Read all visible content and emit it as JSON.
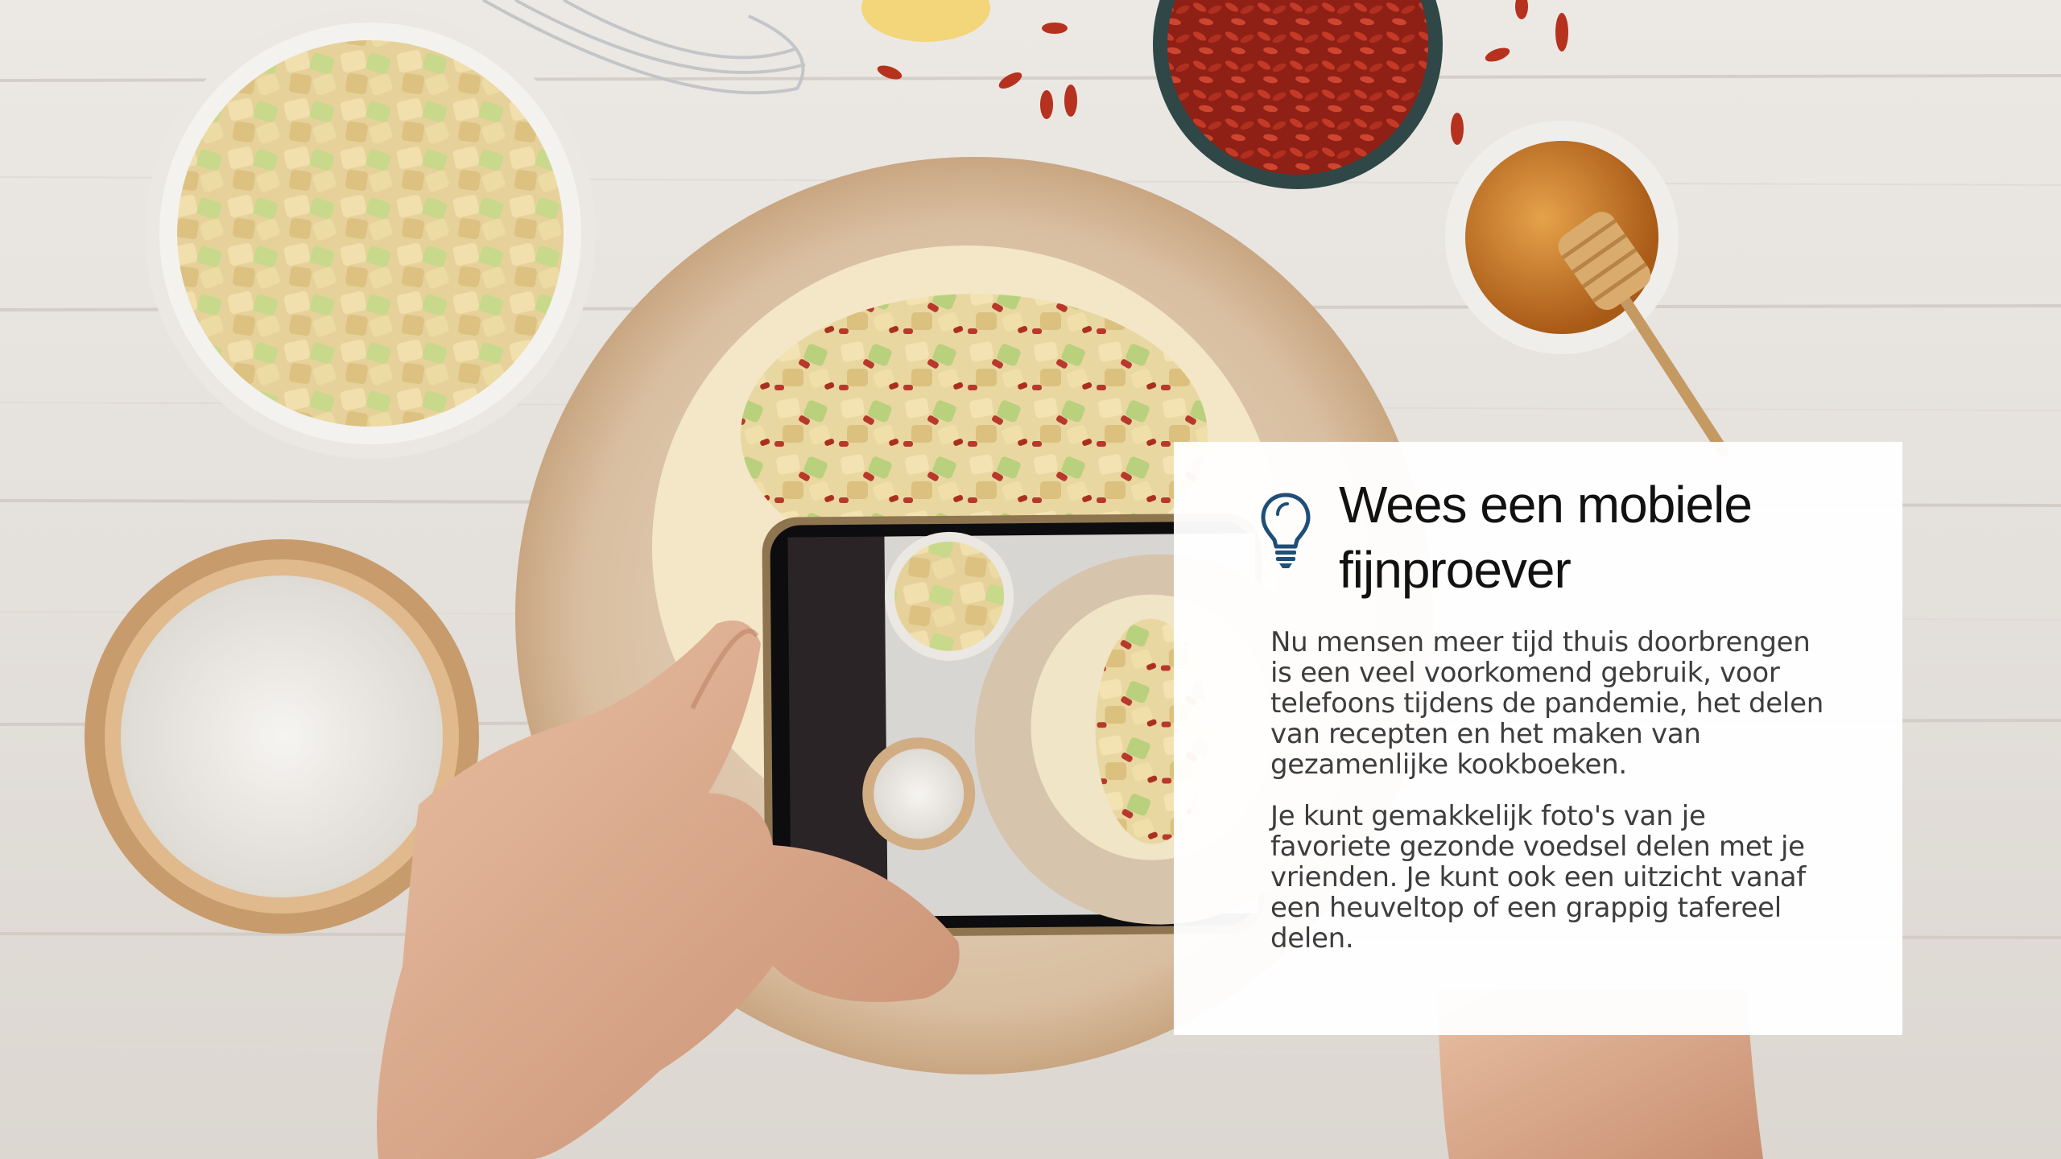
{
  "slide": {
    "title": "Wees een mobiele fijnproever",
    "paragraphs": [
      "Nu mensen meer tijd thuis doorbrengen is een veel voorkomend gebruik, voor telefoons tijdens de pandemie, het delen van recepten en het maken van gezamenlijke kookboeken.",
      "Je kunt gemakkelijk foto's van je favoriete gezonde voedsel delen met je vrienden. Je kunt ook een uitzicht vanaf een heuveltop of een grappig tafereel delen."
    ],
    "icon": "lightbulb-icon",
    "accent_color": "#1f4e79"
  }
}
